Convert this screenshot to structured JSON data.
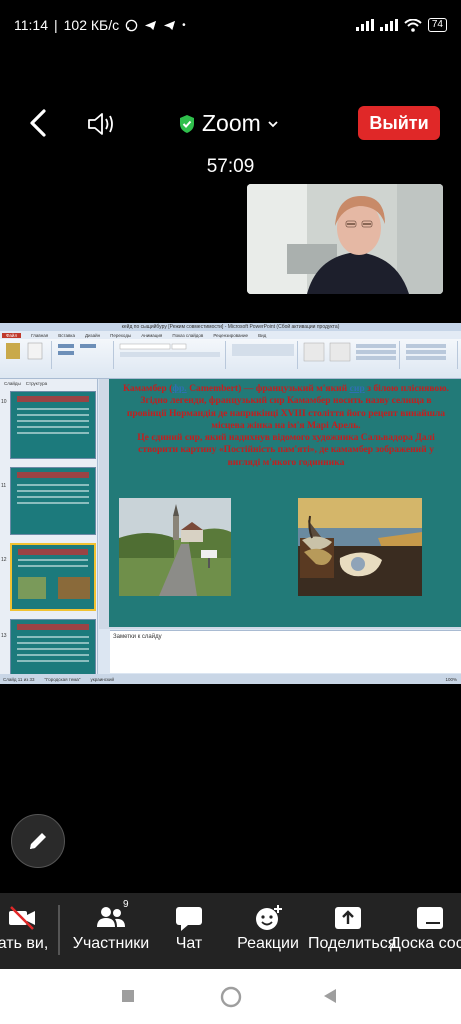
{
  "status_bar": {
    "time": "11:14",
    "speed": "102 КБ/с",
    "battery": "74"
  },
  "header": {
    "app_name": "Zoom",
    "leave_label": "Выйти",
    "timer": "57:09"
  },
  "powerpoint": {
    "window_title": "кейд по сыщийбуру [Режим совместимости] - Microsoft PowerPoint (Сбой активации продукта)",
    "tabs": [
      "Файл",
      "Главная",
      "Вставка",
      "Дизайн",
      "Переходы",
      "Анимация",
      "Показ слайдов",
      "Рецензирование",
      "Вид"
    ],
    "panel_tabs": [
      "Слайды",
      "Структура"
    ],
    "thumb_numbers": [
      "10",
      "11",
      "12",
      "13"
    ],
    "slide": {
      "line1_a": "Камамбер (",
      "line1_link": "фр.",
      "line1_b": " Camembert) — французький м'який ",
      "line1_link2": "сир",
      "line1_c": " з білою пліснявою. Згідно легенди, французький сир Камамбер носить назву селища в провінції Нормандія де наприкінці XVIII століття його рецепт винайшла місцева жінка на ім'я Марі Арель.",
      "line2": "Це єдиний сир, який надихнув відомого художника Сальвадора Далі створити картину «Постійність пам'яті», де камамбер зображений у вигляді м'якого годинника"
    },
    "notes_placeholder": "Заметки к слайду",
    "status": {
      "slide_info": "Слайд 11 из 33",
      "theme": "\"Городская тема\"",
      "language": "украинский",
      "zoom": "100%"
    }
  },
  "toolbar": {
    "items": [
      {
        "label": "ать ви,",
        "icon": "video-off-icon"
      },
      {
        "label": "Участники",
        "icon": "participants-icon",
        "badge": "9"
      },
      {
        "label": "Чат",
        "icon": "chat-icon"
      },
      {
        "label": "Реакции",
        "icon": "reactions-icon"
      },
      {
        "label": "Поделиться",
        "icon": "share-icon"
      },
      {
        "label": "Доска сос",
        "icon": "whiteboard-icon"
      }
    ]
  },
  "colors": {
    "leave_red": "#e02828",
    "slide_teal": "#227a78",
    "slide_text_red": "#c21f1f"
  }
}
